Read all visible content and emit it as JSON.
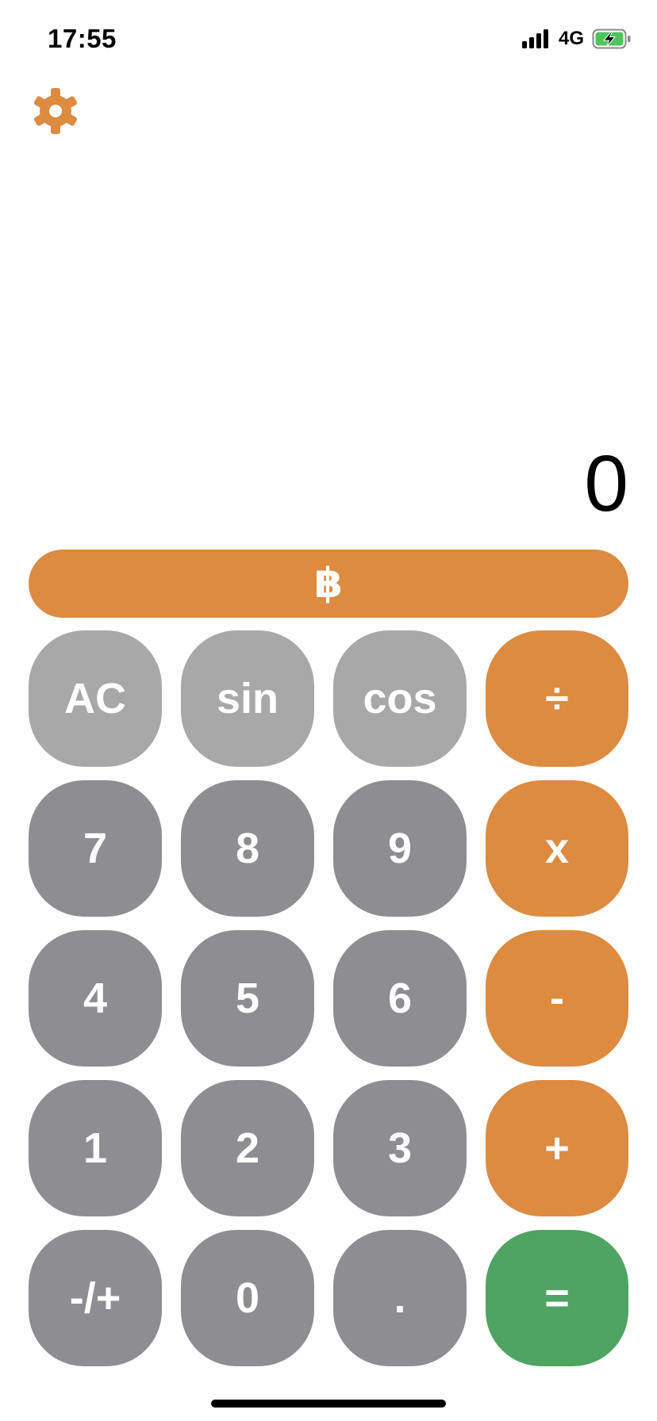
{
  "status_bar": {
    "time": "17:55",
    "network": "4G",
    "signal_icon": "signal-bars-icon",
    "battery_icon": "battery-charging-icon"
  },
  "settings": {
    "icon": "gear-icon"
  },
  "display": {
    "value": "0"
  },
  "btc_button": {
    "label": "฿"
  },
  "keys": {
    "ac": "AC",
    "sin": "sin",
    "cos": "cos",
    "divide": "÷",
    "seven": "7",
    "eight": "8",
    "nine": "9",
    "multiply": "x",
    "four": "4",
    "five": "5",
    "six": "6",
    "subtract": "-",
    "one": "1",
    "two": "2",
    "three": "3",
    "add": "+",
    "negate": "-/+",
    "zero": "0",
    "decimal": ".",
    "equals": "="
  },
  "colors": {
    "accent_orange": "#dd8b40",
    "equals_green": "#4ea462",
    "function_gray": "#a8a8a8",
    "digit_gray": "#8e8e92",
    "battery_green": "#4fc45e"
  }
}
